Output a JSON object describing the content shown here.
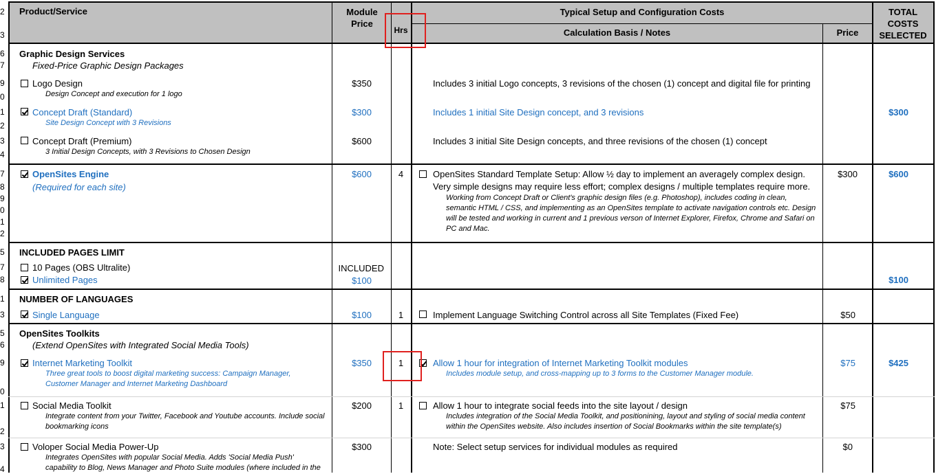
{
  "row_numbers": [
    "2",
    "3",
    "6",
    "7",
    "9",
    "0",
    "1",
    "2",
    "3",
    "4",
    "7",
    "8",
    "9",
    "0",
    "1",
    "2",
    "5",
    "7",
    "8",
    "1",
    "3",
    "5",
    "6",
    "9",
    "0",
    "1",
    "2",
    "3",
    "4"
  ],
  "header": {
    "product": "Product/Service",
    "module_price": "Module Price",
    "hrs": "Hrs",
    "setup_title": "Typical Setup and Configuration Costs",
    "calc_basis": "Calculation Basis / Notes",
    "price": "Price",
    "total": "TOTAL COSTS SELECTED"
  },
  "graphic_design": {
    "title": "Graphic Design Services",
    "subtitle": "Fixed-Price Graphic Design Packages",
    "logo": {
      "label": "Logo Design",
      "desc": "Design Concept and execution for 1 logo",
      "price": "$350",
      "note": "Includes 3 initial Logo concepts, 3 revisions of the chosen (1) concept and digital file for printing"
    },
    "concept_std": {
      "label": "Concept Draft (Standard)",
      "desc": "Site Design Concept with 3 Revisions",
      "price": "$300",
      "note": "Includes 1 initial Site Design concept, and 3 revisions",
      "total": "$300"
    },
    "concept_prem": {
      "label": "Concept Draft (Premium)",
      "desc": "3 Initial Design Concepts, with 3 Revisions to Chosen Design",
      "price": "$600",
      "note": "Includes 3 initial Site Design concepts, and three revisions of the chosen (1) concept"
    }
  },
  "engine": {
    "label": "OpenSites Engine",
    "desc": "(Required for each site)",
    "price": "$600",
    "hrs": "4",
    "note1": "OpenSites Standard Template Setup: Allow ½ day to implement an averagely complex design.",
    "note2": "Very simple designs may require less effort; complex designs / multiple templates require more.",
    "detail1": "Working from Concept Draft or Client's graphic design files (e.g. Photoshop), includes coding in clean,",
    "detail2": "semantic HTML / CSS, and implementing as an OpenSites template to activate navigation controls etc. Design",
    "detail3": "will be tested and working in current and 1 previous verson of Internet Explorer, Firefox, Chrome and Safari on",
    "detail4": "PC and Mac.",
    "setup_price": "$300",
    "total": "$600"
  },
  "pages": {
    "title": "INCLUDED PAGES LIMIT",
    "opt1": {
      "label": "10 Pages (OBS Ultralite)",
      "price": "INCLUDED"
    },
    "opt2": {
      "label": "Unlimited Pages",
      "price": "$100",
      "total": "$100"
    }
  },
  "languages": {
    "title": "NUMBER OF LANGUAGES",
    "opt1": {
      "label": "Single Language",
      "price": "$100",
      "hrs": "1",
      "note": "Implement Language Switching Control across all Site Templates (Fixed Fee)",
      "setup_price": "$50"
    }
  },
  "toolkits": {
    "title": "OpenSites Toolkits",
    "subtitle": "(Extend OpenSites with Integrated Social Media Tools)",
    "imt": {
      "label": "Internet Marketing Toolkit",
      "desc1": "Three great tools to boost digital marketing success: Campaign Manager,",
      "desc2": "Customer Manager and Internet Marketing Dashboard",
      "price": "$350",
      "hrs": "1",
      "note": "Allow 1 hour for integration of Internet Marketing Toolkit modules",
      "detail": "Includes module setup, and cross-mapping up to 3 forms to the Customer Manager module.",
      "setup_price": "$75",
      "total": "$425"
    },
    "smt": {
      "label": "Social Media Toolkit",
      "desc1": "Integrate content from your Twitter, Facebook and Youtube accounts. Include social",
      "desc2": "bookmarking icons",
      "price": "$200",
      "hrs": "1",
      "note": "Allow 1 hour to integrate social feeds into the site layout / design",
      "detail1": "Includes integration of the Social Media Toolkit, and positionining, layout and styling of social media content",
      "detail2": "within the OpenSites website.  Also includes insertion of Social Bookmarks within the site template(s)",
      "setup_price": "$75"
    },
    "vsm": {
      "label": "Voloper Social Media Power-Up",
      "desc1": "Integrates OpenSites with popular Social Media. Adds 'Social Media Push'",
      "desc2": "capability to Blog, News Manager and Photo Suite modules (where included in the",
      "price": "$300",
      "note": "Note:  Select setup services for individual modules as required",
      "setup_price": "$0"
    }
  }
}
